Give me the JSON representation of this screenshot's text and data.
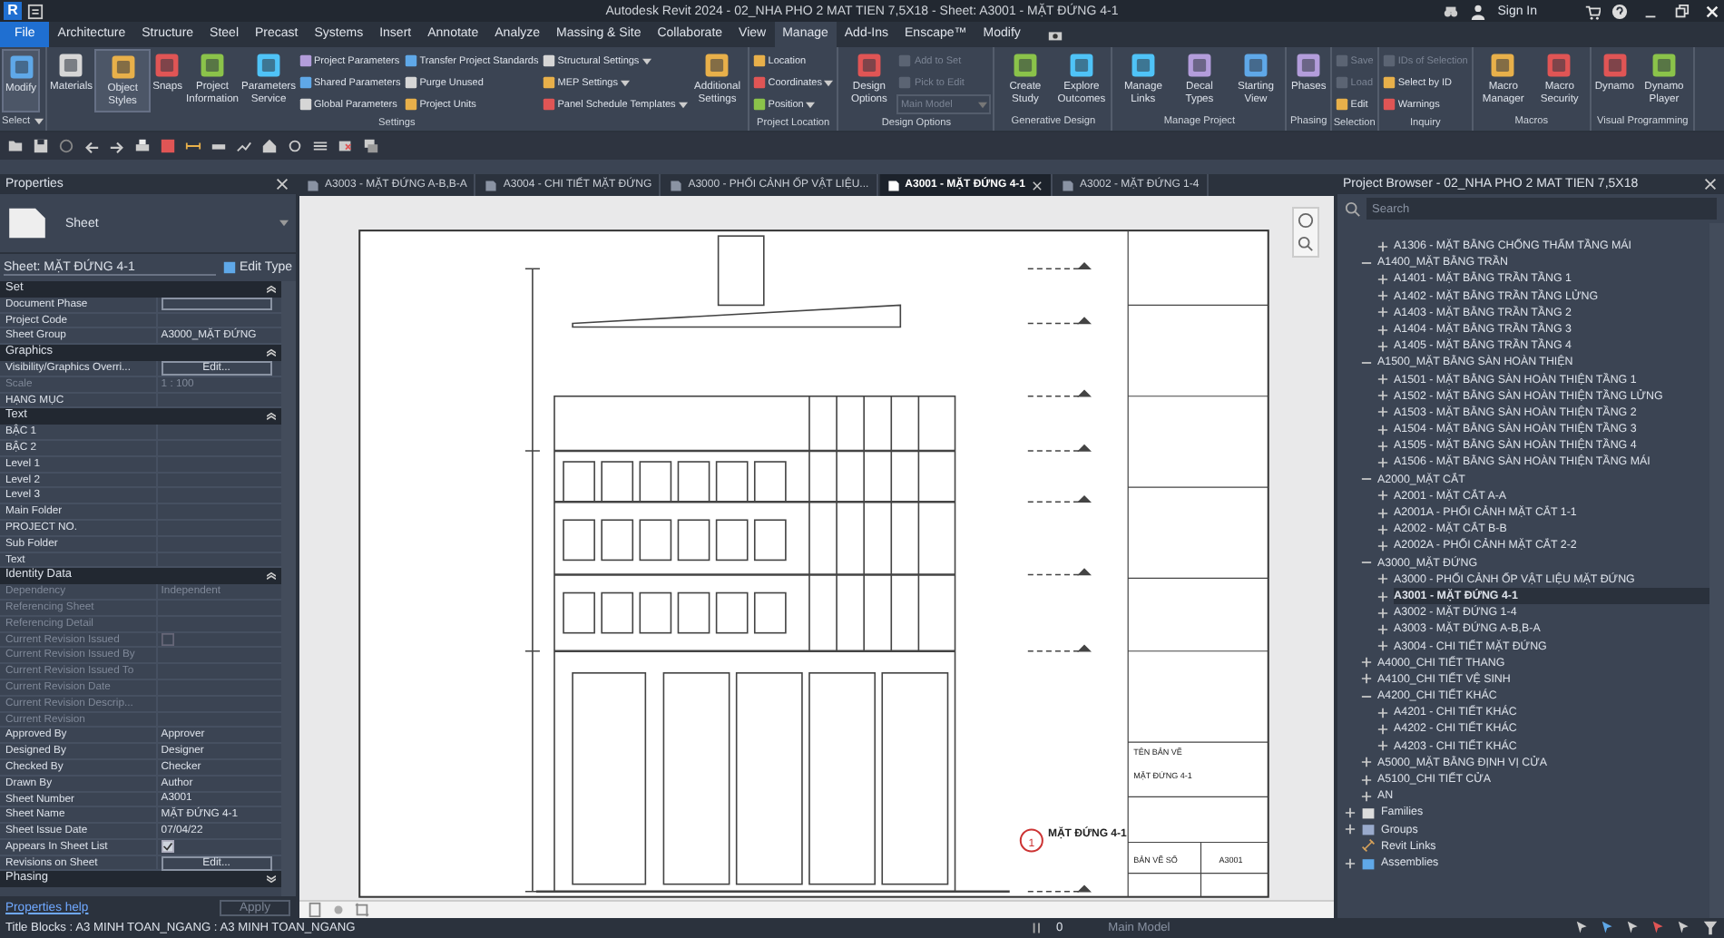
{
  "window": {
    "logo": "R",
    "title": "Autodesk Revit 2024 - 02_NHA PHO 2 MAT TIEN 7,5X18 - Sheet: A3001 - MẶT ĐỨNG 4-1",
    "sign_in": "Sign In"
  },
  "ribbon_tabs": [
    {
      "label": "File",
      "kind": "file",
      "selected": false
    },
    {
      "label": "Architecture",
      "kind": "tab",
      "selected": false
    },
    {
      "label": "Structure",
      "kind": "tab",
      "selected": false
    },
    {
      "label": "Steel",
      "kind": "tab",
      "selected": false
    },
    {
      "label": "Precast",
      "kind": "tab",
      "selected": false
    },
    {
      "label": "Systems",
      "kind": "tab",
      "selected": false
    },
    {
      "label": "Insert",
      "kind": "tab",
      "selected": false
    },
    {
      "label": "Annotate",
      "kind": "tab",
      "selected": false
    },
    {
      "label": "Analyze",
      "kind": "tab",
      "selected": false
    },
    {
      "label": "Massing & Site",
      "kind": "tab",
      "selected": false
    },
    {
      "label": "Collaborate",
      "kind": "tab",
      "selected": false
    },
    {
      "label": "View",
      "kind": "tab",
      "selected": false
    },
    {
      "label": "Manage",
      "kind": "tab",
      "selected": true
    },
    {
      "label": "Add-Ins",
      "kind": "tab",
      "selected": false
    },
    {
      "label": "Enscape™",
      "kind": "tab",
      "selected": false
    },
    {
      "label": "Modify",
      "kind": "tab",
      "selected": false
    }
  ],
  "ribbon_groups": [
    {
      "label": "Select",
      "menu": true,
      "items": [
        {
          "kind": "large",
          "label": "Modify",
          "selected": true
        }
      ]
    },
    {
      "label": "Settings",
      "menu": false,
      "items": [
        {
          "kind": "large",
          "label": "Materials",
          "selected": false
        },
        {
          "kind": "large",
          "label": "Object Styles",
          "selected": true
        },
        {
          "kind": "large",
          "label": "Snaps",
          "selected": false
        },
        {
          "kind": "large",
          "label": "Project Information",
          "selected": false
        },
        {
          "kind": "large",
          "label": "Parameters Service",
          "selected": false
        },
        {
          "kind": "stack",
          "entries": [
            {
              "label": "Project Parameters",
              "disabled": false,
              "dropdown": false
            },
            {
              "label": "Shared Parameters",
              "disabled": false,
              "dropdown": false
            },
            {
              "label": "Global Parameters",
              "disabled": false,
              "dropdown": false
            }
          ]
        },
        {
          "kind": "stack",
          "entries": [
            {
              "label": "Transfer Project Standards",
              "disabled": false,
              "dropdown": false
            },
            {
              "label": "Purge Unused",
              "disabled": false,
              "dropdown": false
            },
            {
              "label": "Project Units",
              "disabled": false,
              "dropdown": false
            }
          ]
        },
        {
          "kind": "stack",
          "entries": [
            {
              "label": "Structural Settings",
              "disabled": false,
              "dropdown": true
            },
            {
              "label": "MEP Settings",
              "disabled": false,
              "dropdown": true
            },
            {
              "label": "Panel Schedule Templates",
              "disabled": false,
              "dropdown": true
            }
          ]
        },
        {
          "kind": "large",
          "label": "Additional Settings",
          "selected": false
        }
      ]
    },
    {
      "label": "Project Location",
      "menu": false,
      "items": [
        {
          "kind": "stack",
          "entries": [
            {
              "label": "Location",
              "disabled": false,
              "dropdown": false
            },
            {
              "label": "Coordinates",
              "disabled": false,
              "dropdown": true
            },
            {
              "label": "Position",
              "disabled": false,
              "dropdown": true
            }
          ]
        }
      ]
    },
    {
      "label": "Design Options",
      "menu": false,
      "items": [
        {
          "kind": "large",
          "label": "Design Options",
          "selected": false
        },
        {
          "kind": "stack",
          "entries": [
            {
              "label": "Add to Set",
              "disabled": true,
              "dropdown": false
            },
            {
              "label": "Pick to Edit",
              "disabled": true,
              "dropdown": false
            },
            {
              "label": "Main Model",
              "disabled": true,
              "dropdown": true,
              "select": true
            }
          ]
        }
      ]
    },
    {
      "label": "Generative Design",
      "menu": false,
      "items": [
        {
          "kind": "large",
          "label": "Create Study",
          "selected": false
        },
        {
          "kind": "large",
          "label": "Explore Outcomes",
          "selected": false
        }
      ]
    },
    {
      "label": "Manage Project",
      "menu": false,
      "items": [
        {
          "kind": "large",
          "label": "Manage Links",
          "selected": false
        },
        {
          "kind": "large",
          "label": "Decal Types",
          "selected": false
        },
        {
          "kind": "large",
          "label": "Starting View",
          "selected": false
        }
      ]
    },
    {
      "label": "Phasing",
      "menu": false,
      "items": [
        {
          "kind": "large",
          "label": "Phases",
          "selected": false
        }
      ]
    },
    {
      "label": "Selection",
      "menu": false,
      "items": [
        {
          "kind": "stack",
          "entries": [
            {
              "label": "Save",
              "disabled": true,
              "dropdown": false
            },
            {
              "label": "Load",
              "disabled": true,
              "dropdown": false
            },
            {
              "label": "Edit",
              "disabled": false,
              "dropdown": false
            }
          ]
        }
      ]
    },
    {
      "label": "Inquiry",
      "menu": false,
      "items": [
        {
          "kind": "stack",
          "entries": [
            {
              "label": "IDs of Selection",
              "disabled": true,
              "dropdown": false
            },
            {
              "label": "Select by ID",
              "disabled": false,
              "dropdown": false
            },
            {
              "label": "Warnings",
              "disabled": false,
              "dropdown": false
            }
          ]
        }
      ]
    },
    {
      "label": "Macros",
      "menu": false,
      "items": [
        {
          "kind": "large",
          "label": "Macro Manager",
          "selected": false
        },
        {
          "kind": "large",
          "label": "Macro Security",
          "selected": false
        }
      ]
    },
    {
      "label": "Visual Programming",
      "menu": false,
      "items": [
        {
          "kind": "large",
          "label": "Dynamo",
          "selected": false
        },
        {
          "kind": "large",
          "label": "Dynamo Player",
          "selected": false
        }
      ]
    }
  ],
  "properties": {
    "title": "Properties",
    "type_name": "Sheet",
    "instance": "Sheet: MẶT ĐỨNG 4-1",
    "edit_type": "Edit Type",
    "sections": [
      {
        "title": "Set",
        "expanded": true,
        "rows": [
          {
            "label": "Document Phase",
            "kind": "input",
            "disabled": false
          },
          {
            "label": "Project Code",
            "kind": "text",
            "disabled": false
          },
          {
            "label": "Sheet Group",
            "kind": "text",
            "value": "A3000_MẶT ĐỨNG",
            "disabled": false
          }
        ]
      },
      {
        "title": "Graphics",
        "expanded": true,
        "rows": [
          {
            "label": "Visibility/Graphics Overri...",
            "kind": "edit",
            "value": "Edit...",
            "disabled": false
          },
          {
            "label": "Scale",
            "kind": "text",
            "value": "1 : 100",
            "disabled": true
          },
          {
            "label": "HẠNG MỤC",
            "kind": "text",
            "disabled": false
          }
        ]
      },
      {
        "title": "Text",
        "expanded": true,
        "rows": [
          {
            "label": "BẬC 1",
            "kind": "text",
            "disabled": false
          },
          {
            "label": "BẬC 2",
            "kind": "text",
            "disabled": false
          },
          {
            "label": "Level 1",
            "kind": "text",
            "disabled": false
          },
          {
            "label": "Level 2",
            "kind": "text",
            "disabled": false
          },
          {
            "label": "Level 3",
            "kind": "text",
            "disabled": false
          },
          {
            "label": "Main Folder",
            "kind": "text",
            "disabled": false
          },
          {
            "label": "PROJECT NO.",
            "kind": "text",
            "disabled": false
          },
          {
            "label": "Sub Folder",
            "kind": "text",
            "disabled": false
          },
          {
            "label": "Text",
            "kind": "text",
            "disabled": false
          }
        ]
      },
      {
        "title": "Identity Data",
        "expanded": true,
        "rows": [
          {
            "label": "Dependency",
            "kind": "text",
            "value": "Independent",
            "disabled": true
          },
          {
            "label": "Referencing Sheet",
            "kind": "text",
            "disabled": true
          },
          {
            "label": "Referencing Detail",
            "kind": "text",
            "disabled": true
          },
          {
            "label": "Current Revision Issued",
            "kind": "check",
            "checked": false,
            "disabled": true
          },
          {
            "label": "Current Revision Issued By",
            "kind": "text",
            "disabled": true
          },
          {
            "label": "Current Revision Issued To",
            "kind": "text",
            "disabled": true
          },
          {
            "label": "Current Revision Date",
            "kind": "text",
            "disabled": true
          },
          {
            "label": "Current Revision Descrip...",
            "kind": "text",
            "disabled": true
          },
          {
            "label": "Current Revision",
            "kind": "text",
            "disabled": true
          },
          {
            "label": "Approved By",
            "kind": "text",
            "value": "Approver",
            "disabled": false
          },
          {
            "label": "Designed By",
            "kind": "text",
            "value": "Designer",
            "disabled": false
          },
          {
            "label": "Checked By",
            "kind": "text",
            "value": "Checker",
            "disabled": false
          },
          {
            "label": "Drawn By",
            "kind": "text",
            "value": "Author",
            "disabled": false
          },
          {
            "label": "Sheet Number",
            "kind": "text",
            "value": "A3001",
            "disabled": false
          },
          {
            "label": "Sheet Name",
            "kind": "text",
            "value": "MẶT ĐỨNG 4-1",
            "disabled": false
          },
          {
            "label": "Sheet Issue Date",
            "kind": "text",
            "value": "07/04/22",
            "disabled": false
          },
          {
            "label": "Appears In Sheet List",
            "kind": "check",
            "checked": true,
            "disabled": false
          },
          {
            "label": "Revisions on Sheet",
            "kind": "edit",
            "value": "Edit...",
            "disabled": false
          }
        ]
      },
      {
        "title": "Phasing",
        "expanded": false
      }
    ],
    "help": "Properties help",
    "apply": "Apply",
    "apply_disabled": true
  },
  "view_tabs": [
    {
      "label": "A3003 - MẶT ĐỨNG A-B,B-A",
      "selected": false
    },
    {
      "label": "A3004 - CHI TIẾT MẶT ĐỨNG",
      "selected": false
    },
    {
      "label": "A3000 - PHỐI CẢNH ỐP VẬT LIỆU...",
      "selected": false
    },
    {
      "label": "A3001 - MẶT ĐỨNG 4-1",
      "selected": true
    },
    {
      "label": "A3002 - MẶT ĐỨNG 1-4",
      "selected": false
    }
  ],
  "sheet": {
    "view_number": "1",
    "view_title": "MẶT ĐỨNG 4-1",
    "drawing_name_label": "TÊN BẢN VẼ",
    "drawing_name": "MẶT ĐỨNG 4-1",
    "sheet_no_label": "BẢN VẼ SỐ",
    "sheet_no": "A3001"
  },
  "browser": {
    "title": "Project Browser - 02_NHA PHO 2 MAT TIEN 7,5X18",
    "search_placeholder": "Search",
    "sheets_tail": [
      {
        "label": "A1306 - MẶT BẰNG CHỐNG THẤM TẦNG MÁI",
        "expanded": false,
        "selected": false
      }
    ],
    "sheet_groups": [
      {
        "label": "A1400_MẶT BẰNG TRẦN",
        "expanded": true,
        "selected": false,
        "children": [
          {
            "label": "A1401 - MẶT BẰNG TRẦN TẦNG 1",
            "expanded": false,
            "selected": false
          },
          {
            "label": "A1402 - MẶT BẰNG TRẦN TẦNG LỬNG",
            "expanded": false,
            "selected": false
          },
          {
            "label": "A1403 - MẶT BẰNG TRẦN TẦNG 2",
            "expanded": false,
            "selected": false
          },
          {
            "label": "A1404 - MẶT BẰNG TRẦN TẦNG 3",
            "expanded": false,
            "selected": false
          },
          {
            "label": "A1405 - MẶT BẰNG TRẦN TẦNG 4",
            "expanded": false,
            "selected": false
          }
        ]
      },
      {
        "label": "A1500_MẶT BẰNG SÀN HOÀN THIỆN",
        "expanded": true,
        "selected": false,
        "children": [
          {
            "label": "A1501 - MẶT BẰNG SÀN HOÀN THIỆN TẦNG 1",
            "expanded": false,
            "selected": false
          },
          {
            "label": "A1502 - MẶT BẰNG SÀN HOÀN THIỆN TẦNG LỬNG",
            "expanded": false,
            "selected": false
          },
          {
            "label": "A1503 - MẶT BẰNG SÀN HOÀN THIỆN TẦNG 2",
            "expanded": false,
            "selected": false
          },
          {
            "label": "A1504 - MẶT BẰNG SÀN HOÀN THIỆN TẦNG 3",
            "expanded": false,
            "selected": false
          },
          {
            "label": "A1505 - MẶT BẰNG SÀN HOÀN THIỆN TẦNG 4",
            "expanded": false,
            "selected": false
          },
          {
            "label": "A1506 - MẶT BẰNG SÀN HOÀN THIỆN TẦNG MÁI",
            "expanded": false,
            "selected": false
          }
        ]
      },
      {
        "label": "A2000_MẶT CẮT",
        "expanded": true,
        "selected": false,
        "children": [
          {
            "label": "A2001 - MẶT CẮT A-A",
            "expanded": false,
            "selected": false
          },
          {
            "label": "A2001A - PHỐI CẢNH MẶT CẮT 1-1",
            "expanded": false,
            "selected": false
          },
          {
            "label": "A2002 - MẶT CẮT B-B",
            "expanded": false,
            "selected": false
          },
          {
            "label": "A2002A - PHỐI CẢNH MẶT CẮT 2-2",
            "expanded": false,
            "selected": false
          }
        ]
      },
      {
        "label": "A3000_MẶT ĐỨNG",
        "expanded": true,
        "selected": false,
        "children": [
          {
            "label": "A3000 - PHỐI CẢNH ỐP VẬT LIỆU MẶT ĐỨNG",
            "expanded": false,
            "selected": false
          },
          {
            "label": "A3001 - MẶT ĐỨNG 4-1",
            "expanded": false,
            "selected": true
          },
          {
            "label": "A3002 - MẶT ĐỨNG 1-4",
            "expanded": false,
            "selected": false
          },
          {
            "label": "A3003 - MẶT ĐỨNG A-B,B-A",
            "expanded": false,
            "selected": false
          },
          {
            "label": "A3004 - CHI TIẾT MẶT ĐỨNG",
            "expanded": false,
            "selected": false
          }
        ]
      },
      {
        "label": "A4000_CHI TIẾT THANG",
        "expanded": false,
        "selected": false
      },
      {
        "label": "A4100_CHI TIẾT VỆ SINH",
        "expanded": false,
        "selected": false
      },
      {
        "label": "A4200_CHI TIẾT KHÁC",
        "expanded": true,
        "selected": false,
        "children": [
          {
            "label": "A4201 - CHI TIẾT KHÁC",
            "expanded": false,
            "selected": false
          },
          {
            "label": "A4202 - CHI TIẾT KHÁC",
            "expanded": false,
            "selected": false
          },
          {
            "label": "A4203 - CHI TIẾT KHÁC",
            "expanded": false,
            "selected": false
          }
        ]
      },
      {
        "label": "A5000_MẶT BẰNG ĐỊNH VỊ CỬA",
        "expanded": false,
        "selected": false
      },
      {
        "label": "A5100_CHI TIẾT CỬA",
        "expanded": false,
        "selected": false
      },
      {
        "label": "AN",
        "expanded": false,
        "selected": false
      }
    ],
    "categories": [
      {
        "label": "Families",
        "expandable": true,
        "expanded": false,
        "selected": false
      },
      {
        "label": "Groups",
        "expandable": true,
        "expanded": false,
        "selected": false
      },
      {
        "label": "Revit Links",
        "expandable": false,
        "selected": false
      },
      {
        "label": "Assemblies",
        "expandable": true,
        "expanded": false,
        "selected": false
      }
    ]
  },
  "status_bar": {
    "text": "Title Blocks : A3 MINH TOAN_NGANG : A3 MINH TOAN_NGANG",
    "count": "0",
    "model": "Main Model"
  }
}
